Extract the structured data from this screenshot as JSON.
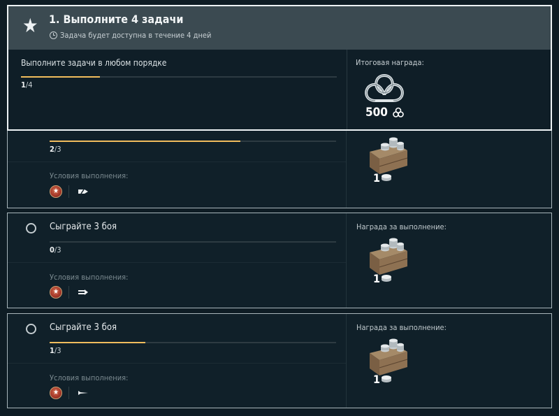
{
  "header": {
    "title": "1. Выполните 4 задачи",
    "availability": "Задача будет доступна в течение 4 дней",
    "instruction": "Выполните задачи в любом порядке",
    "progress_current": "1",
    "progress_total": "/4",
    "progress_fraction": 0.25,
    "final_reward_label": "Итоговая награда:",
    "final_reward_amount": "500"
  },
  "tasks": [
    {
      "title": "",
      "progress_current": "2",
      "progress_total": "/3",
      "progress_fraction": 0.667,
      "conditions_label": "Условия выполнения:",
      "reward_label": "",
      "reward_count": "1",
      "ship_class_icon": "destroyer-icon"
    },
    {
      "title": "Сыграйте 3 боя",
      "progress_current": "0",
      "progress_total": "/3",
      "progress_fraction": 0.0,
      "conditions_label": "Условия выполнения:",
      "reward_label": "Награда за выполнение:",
      "reward_count": "1",
      "ship_class_icon": "cruiser-icon"
    },
    {
      "title": "Сыграйте 3 боя",
      "progress_current": "1",
      "progress_total": "/3",
      "progress_fraction": 0.333,
      "conditions_label": "Условия выполнения:",
      "reward_label": "Награда за выполнение:",
      "reward_count": "1",
      "ship_class_icon": "battleship-icon"
    }
  ],
  "colors": {
    "accent_progress": "#f0bc5d",
    "background": "#0e1c24",
    "header_band": "#3b4a51"
  }
}
